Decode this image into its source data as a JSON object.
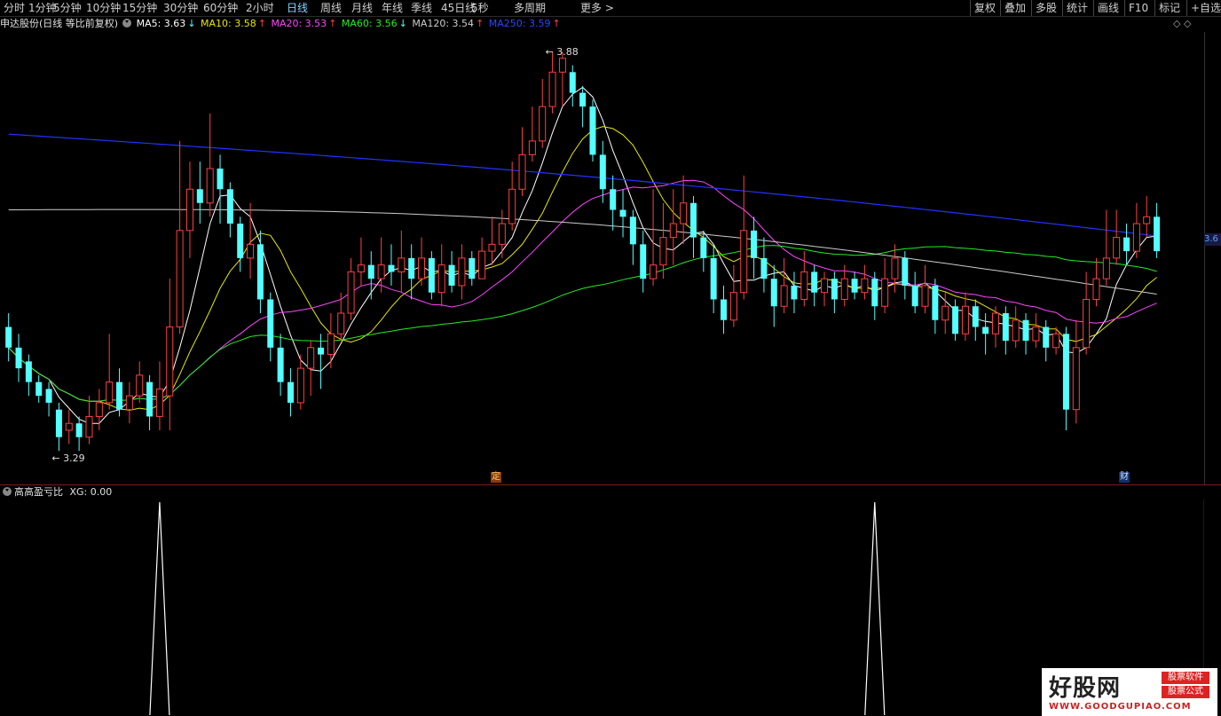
{
  "toolbar": {
    "periods": [
      "分时",
      "1分钟",
      "5分钟",
      "10分钟",
      "15分钟",
      "30分钟",
      "60分钟",
      "2小时",
      "日线",
      "周线",
      "月线",
      "年线",
      "季线",
      "45日线",
      "5秒",
      "多周期",
      "更多 >"
    ],
    "active_period": "日线",
    "right": [
      "复权",
      "叠加",
      "多股",
      "统计",
      "画线",
      "F10",
      "标记",
      "+自选"
    ]
  },
  "info": {
    "stock": "申达股份(日线 等比前复权)",
    "ma5": {
      "label": "MA5: 3.63",
      "arrow": "↓",
      "color": "#ffffff"
    },
    "ma10": {
      "label": "MA10: 3.58",
      "arrow": "↑",
      "color": "#e6e600"
    },
    "ma20": {
      "label": "MA20: 3.53",
      "arrow": "↑",
      "color": "#ff44ff"
    },
    "ma60": {
      "label": "MA60: 3.56",
      "arrow": "↓",
      "color": "#22ee22"
    },
    "ma120": {
      "label": "MA120: 3.54",
      "arrow": "↑",
      "color": "#cccccc"
    },
    "ma250": {
      "label": "MA250: 3.59",
      "arrow": "↑",
      "color": "#2233ff"
    }
  },
  "annotations": {
    "high": "3.88",
    "low": "3.29",
    "ding": "定",
    "cai": "财",
    "price_tag": "3.6"
  },
  "indicator": {
    "name": "高高盈亏比",
    "xg": "XG: 0.00"
  },
  "watermark": {
    "title": "好股网",
    "badge1": "股票软件",
    "badge2": "股票公式",
    "url": "WWW.GOODGUPIAO.COM"
  },
  "colors": {
    "up": "#ff4040",
    "down": "#54ffff",
    "axis": "#7a1c1c"
  },
  "chart_data": {
    "type": "candlestick",
    "ylim": [
      3.29,
      3.88
    ],
    "candles": [
      [
        3.48,
        3.45,
        3.5,
        3.43
      ],
      [
        3.45,
        3.42,
        3.47,
        3.4
      ],
      [
        3.43,
        3.4,
        3.44,
        3.38
      ],
      [
        3.4,
        3.38,
        3.41,
        3.37
      ],
      [
        3.39,
        3.37,
        3.4,
        3.35
      ],
      [
        3.36,
        3.32,
        3.37,
        3.3
      ],
      [
        3.33,
        3.34,
        3.36,
        3.31
      ],
      [
        3.34,
        3.32,
        3.35,
        3.3
      ],
      [
        3.32,
        3.35,
        3.38,
        3.31
      ],
      [
        3.35,
        3.37,
        3.39,
        3.33
      ],
      [
        3.37,
        3.4,
        3.47,
        3.36
      ],
      [
        3.4,
        3.36,
        3.42,
        3.35
      ],
      [
        3.36,
        3.38,
        3.4,
        3.34
      ],
      [
        3.38,
        3.41,
        3.43,
        3.37
      ],
      [
        3.4,
        3.35,
        3.41,
        3.33
      ],
      [
        3.35,
        3.39,
        3.43,
        3.33
      ],
      [
        3.38,
        3.48,
        3.55,
        3.33
      ],
      [
        3.48,
        3.62,
        3.75,
        3.47
      ],
      [
        3.62,
        3.68,
        3.72,
        3.58
      ],
      [
        3.68,
        3.66,
        3.72,
        3.63
      ],
      [
        3.66,
        3.71,
        3.79,
        3.64
      ],
      [
        3.71,
        3.68,
        3.73,
        3.63
      ],
      [
        3.68,
        3.63,
        3.69,
        3.61
      ],
      [
        3.63,
        3.58,
        3.64,
        3.56
      ],
      [
        3.58,
        3.6,
        3.66,
        3.55
      ],
      [
        3.6,
        3.52,
        3.62,
        3.5
      ],
      [
        3.52,
        3.45,
        3.53,
        3.43
      ],
      [
        3.45,
        3.4,
        3.47,
        3.38
      ],
      [
        3.4,
        3.37,
        3.42,
        3.35
      ],
      [
        3.37,
        3.42,
        3.44,
        3.36
      ],
      [
        3.42,
        3.45,
        3.46,
        3.38
      ],
      [
        3.45,
        3.44,
        3.47,
        3.39
      ],
      [
        3.44,
        3.47,
        3.5,
        3.42
      ],
      [
        3.47,
        3.5,
        3.53,
        3.46
      ],
      [
        3.5,
        3.56,
        3.58,
        3.49
      ],
      [
        3.56,
        3.57,
        3.61,
        3.54
      ],
      [
        3.57,
        3.55,
        3.59,
        3.52
      ],
      [
        3.55,
        3.57,
        3.61,
        3.53
      ],
      [
        3.57,
        3.56,
        3.6,
        3.54
      ],
      [
        3.56,
        3.58,
        3.62,
        3.53
      ],
      [
        3.58,
        3.55,
        3.6,
        3.52
      ],
      [
        3.55,
        3.58,
        3.61,
        3.54
      ],
      [
        3.58,
        3.53,
        3.59,
        3.52
      ],
      [
        3.53,
        3.57,
        3.6,
        3.51
      ],
      [
        3.57,
        3.54,
        3.59,
        3.53
      ],
      [
        3.54,
        3.58,
        3.6,
        3.52
      ],
      [
        3.58,
        3.55,
        3.59,
        3.54
      ],
      [
        3.55,
        3.59,
        3.61,
        3.55
      ],
      [
        3.59,
        3.6,
        3.64,
        3.57
      ],
      [
        3.6,
        3.63,
        3.65,
        3.58
      ],
      [
        3.63,
        3.68,
        3.72,
        3.62
      ],
      [
        3.68,
        3.73,
        3.77,
        3.67
      ],
      [
        3.73,
        3.75,
        3.8,
        3.72
      ],
      [
        3.75,
        3.8,
        3.84,
        3.74
      ],
      [
        3.8,
        3.85,
        3.88,
        3.79
      ],
      [
        3.85,
        3.87,
        3.88,
        3.8
      ],
      [
        3.85,
        3.82,
        3.86,
        3.8
      ],
      [
        3.82,
        3.8,
        3.83,
        3.77
      ],
      [
        3.8,
        3.73,
        3.81,
        3.72
      ],
      [
        3.73,
        3.68,
        3.75,
        3.66
      ],
      [
        3.68,
        3.65,
        3.7,
        3.62
      ],
      [
        3.65,
        3.64,
        3.68,
        3.61
      ],
      [
        3.64,
        3.6,
        3.65,
        3.57
      ],
      [
        3.6,
        3.55,
        3.62,
        3.53
      ],
      [
        3.55,
        3.57,
        3.68,
        3.54
      ],
      [
        3.57,
        3.61,
        3.66,
        3.55
      ],
      [
        3.61,
        3.63,
        3.68,
        3.57
      ],
      [
        3.63,
        3.66,
        3.7,
        3.6
      ],
      [
        3.66,
        3.61,
        3.67,
        3.58
      ],
      [
        3.61,
        3.58,
        3.62,
        3.56
      ],
      [
        3.58,
        3.52,
        3.6,
        3.5
      ],
      [
        3.52,
        3.49,
        3.54,
        3.47
      ],
      [
        3.49,
        3.53,
        3.57,
        3.48
      ],
      [
        3.53,
        3.62,
        3.7,
        3.52
      ],
      [
        3.62,
        3.58,
        3.64,
        3.55
      ],
      [
        3.58,
        3.55,
        3.61,
        3.53
      ],
      [
        3.55,
        3.51,
        3.57,
        3.48
      ],
      [
        3.51,
        3.54,
        3.58,
        3.5
      ],
      [
        3.54,
        3.52,
        3.56,
        3.5
      ],
      [
        3.52,
        3.56,
        3.59,
        3.51
      ],
      [
        3.56,
        3.53,
        3.57,
        3.51
      ],
      [
        3.53,
        3.55,
        3.56,
        3.51
      ],
      [
        3.55,
        3.52,
        3.56,
        3.5
      ],
      [
        3.52,
        3.55,
        3.57,
        3.51
      ],
      [
        3.55,
        3.53,
        3.56,
        3.52
      ],
      [
        3.53,
        3.55,
        3.57,
        3.52
      ],
      [
        3.55,
        3.51,
        3.56,
        3.49
      ],
      [
        3.51,
        3.55,
        3.58,
        3.5
      ],
      [
        3.55,
        3.58,
        3.6,
        3.53
      ],
      [
        3.58,
        3.54,
        3.59,
        3.52
      ],
      [
        3.54,
        3.51,
        3.56,
        3.5
      ],
      [
        3.51,
        3.54,
        3.57,
        3.5
      ],
      [
        3.54,
        3.49,
        3.55,
        3.47
      ],
      [
        3.49,
        3.51,
        3.53,
        3.47
      ],
      [
        3.51,
        3.47,
        3.52,
        3.46
      ],
      [
        3.47,
        3.51,
        3.53,
        3.46
      ],
      [
        3.51,
        3.48,
        3.52,
        3.46
      ],
      [
        3.48,
        3.47,
        3.5,
        3.44
      ],
      [
        3.47,
        3.5,
        3.51,
        3.45
      ],
      [
        3.5,
        3.46,
        3.51,
        3.44
      ],
      [
        3.46,
        3.49,
        3.51,
        3.45
      ],
      [
        3.49,
        3.46,
        3.5,
        3.44
      ],
      [
        3.46,
        3.48,
        3.5,
        3.45
      ],
      [
        3.48,
        3.45,
        3.49,
        3.43
      ],
      [
        3.45,
        3.47,
        3.48,
        3.44
      ],
      [
        3.47,
        3.36,
        3.48,
        3.33
      ],
      [
        3.36,
        3.45,
        3.49,
        3.34
      ],
      [
        3.45,
        3.52,
        3.56,
        3.44
      ],
      [
        3.52,
        3.55,
        3.58,
        3.51
      ],
      [
        3.55,
        3.58,
        3.65,
        3.54
      ],
      [
        3.58,
        3.61,
        3.65,
        3.57
      ],
      [
        3.61,
        3.59,
        3.63,
        3.57
      ],
      [
        3.59,
        3.63,
        3.66,
        3.58
      ],
      [
        3.63,
        3.64,
        3.67,
        3.61
      ],
      [
        3.64,
        3.59,
        3.66,
        3.58
      ]
    ],
    "xg": {
      "peaks": [
        15,
        86
      ],
      "ylim": [
        0,
        1
      ]
    }
  }
}
